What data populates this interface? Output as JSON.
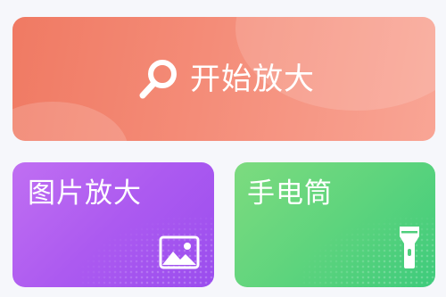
{
  "main_card": {
    "label": "开始放大",
    "icon": "magnifier-icon",
    "color_from": "#f07a63",
    "color_to": "#f9a595"
  },
  "image_card": {
    "label": "图片放大",
    "icon": "image-icon",
    "color_from": "#c06ff2",
    "color_to": "#9a4dee"
  },
  "torch_card": {
    "label": "手电筒",
    "icon": "flashlight-icon",
    "color_from": "#7ddb7f",
    "color_to": "#3ecb7c"
  }
}
